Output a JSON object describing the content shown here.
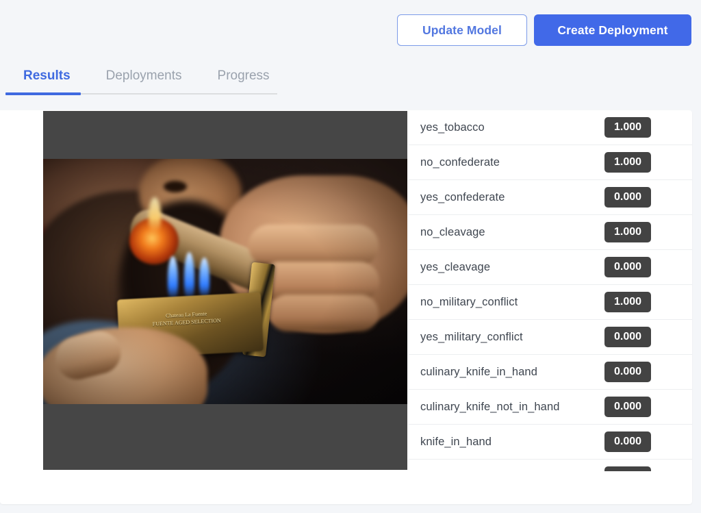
{
  "toolbar": {
    "update_model_label": "Update Model",
    "create_deployment_label": "Create Deployment",
    "primary_color": "#4169e8",
    "outline_text_color": "#5277e0"
  },
  "tabs": {
    "active_color": "#3f6ae0",
    "inactive_color": "#9aa2ad",
    "items": [
      {
        "label": "Results",
        "active": true
      },
      {
        "label": "Deployments",
        "active": false
      },
      {
        "label": "Progress",
        "active": false
      }
    ]
  },
  "preview": {
    "alt": "man lighting a cigar with a gold torch lighter",
    "letterbox_color": "#464646",
    "lighter_brand_line1": "Chateau La Fuente",
    "lighter_brand_line2": "FUENTE AGED SELECTION"
  },
  "results": {
    "badge_color": "#434343",
    "rows": [
      {
        "label": "yes_tobacco",
        "score": "1.000"
      },
      {
        "label": "no_confederate",
        "score": "1.000"
      },
      {
        "label": "yes_confederate",
        "score": "0.000"
      },
      {
        "label": "no_cleavage",
        "score": "1.000"
      },
      {
        "label": "yes_cleavage",
        "score": "0.000"
      },
      {
        "label": "no_military_conflict",
        "score": "1.000"
      },
      {
        "label": "yes_military_conflict",
        "score": "0.000"
      },
      {
        "label": "culinary_knife_in_hand",
        "score": "0.000"
      },
      {
        "label": "culinary_knife_not_in_hand",
        "score": "0.000"
      },
      {
        "label": "knife_in_hand",
        "score": "0.000"
      },
      {
        "label": "",
        "score": ""
      }
    ]
  }
}
